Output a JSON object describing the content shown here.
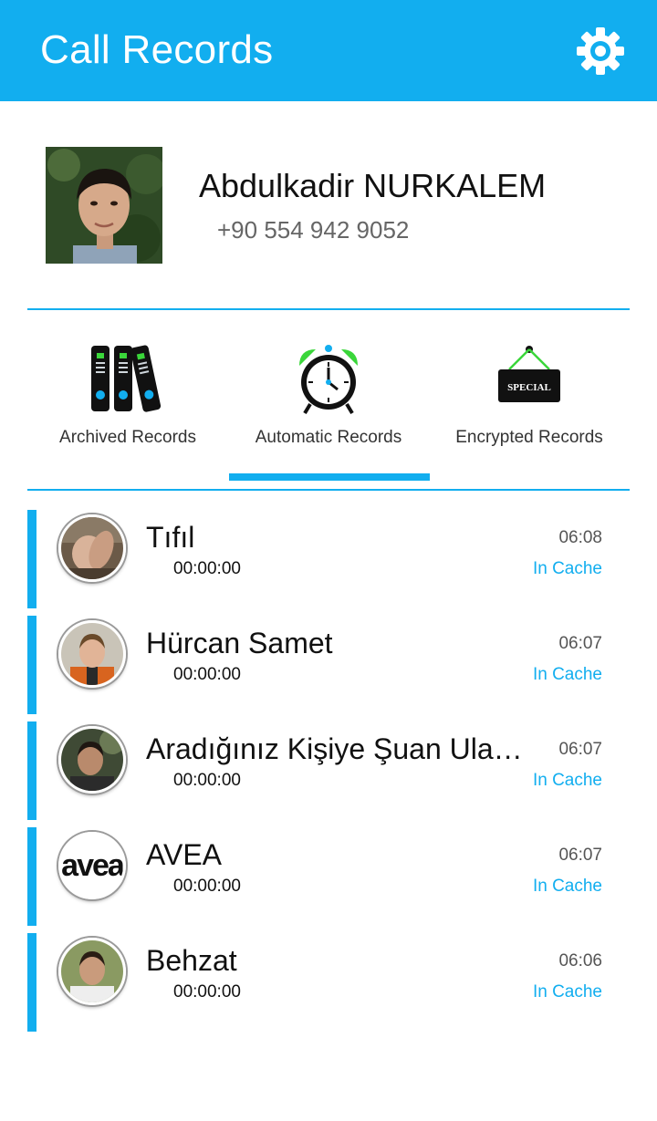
{
  "app": {
    "title": "Call Records"
  },
  "profile": {
    "name": "Abdulkadir NURKALEM",
    "phone": "+90 554 942 9052"
  },
  "tabs": [
    {
      "label": "Archived Records",
      "icon": "binders-icon"
    },
    {
      "label": "Automatic Records",
      "icon": "alarm-clock-icon"
    },
    {
      "label": "Encrypted Records",
      "icon": "special-sign-icon",
      "badge": "SPECIAL"
    }
  ],
  "active_tab": "Automatic Records",
  "calls": [
    {
      "name": "Tıfıl",
      "duration": "00:00:00",
      "time": "06:08",
      "status": "In Cache"
    },
    {
      "name": "Hürcan Samet",
      "duration": "00:00:00",
      "time": "06:07",
      "status": "In Cache"
    },
    {
      "name": "Aradığınız Kişiye Şuan Ulaşılamıyor",
      "duration": "00:00:00",
      "time": "06:07",
      "status": "In Cache"
    },
    {
      "name": "AVEA",
      "duration": "00:00:00",
      "time": "06:07",
      "status": "In Cache",
      "logo_text": "avea"
    },
    {
      "name": "Behzat",
      "duration": "00:00:00",
      "time": "06:06",
      "status": "In Cache"
    }
  ],
  "colors": {
    "accent": "#12aeef",
    "status": "#12aeef",
    "clock_bells": "#3ad63a"
  }
}
